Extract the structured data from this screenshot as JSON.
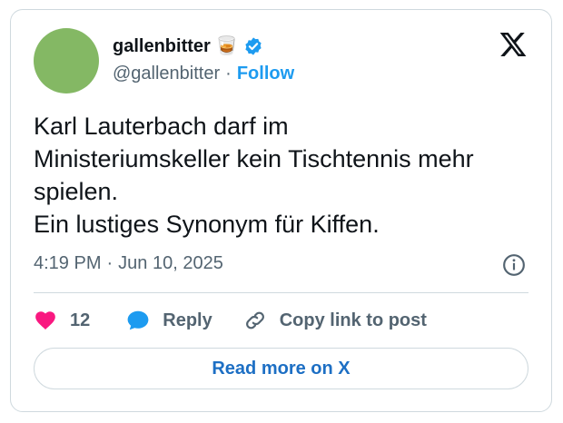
{
  "author": {
    "display_name": "gallenbitter 🥃",
    "handle": "@gallenbitter",
    "separator": "·",
    "follow_label": "Follow",
    "avatar_color": "#84b864",
    "verified_color": "#1d9bf0"
  },
  "tweet": {
    "text": "Karl Lauterbach darf im\nMinisteriumskeller kein Tischtennis mehr\nspielen.\nEin lustiges Synonym für Kiffen.",
    "time": "4:19 PM",
    "separator": "·",
    "date": "Jun 10, 2025"
  },
  "actions": {
    "likes_count": "12",
    "reply_label": "Reply",
    "copy_label": "Copy link to post"
  },
  "footer": {
    "read_more_label": "Read more on X"
  },
  "icons": {
    "brand": "x-logo-icon",
    "info": "info-icon",
    "like": "heart-icon",
    "reply": "speech-bubble-icon",
    "copy": "link-icon"
  },
  "colors": {
    "like": "#f91880",
    "reply": "#1d9bf0",
    "link_text": "#1d6fc4",
    "muted": "#536471"
  }
}
